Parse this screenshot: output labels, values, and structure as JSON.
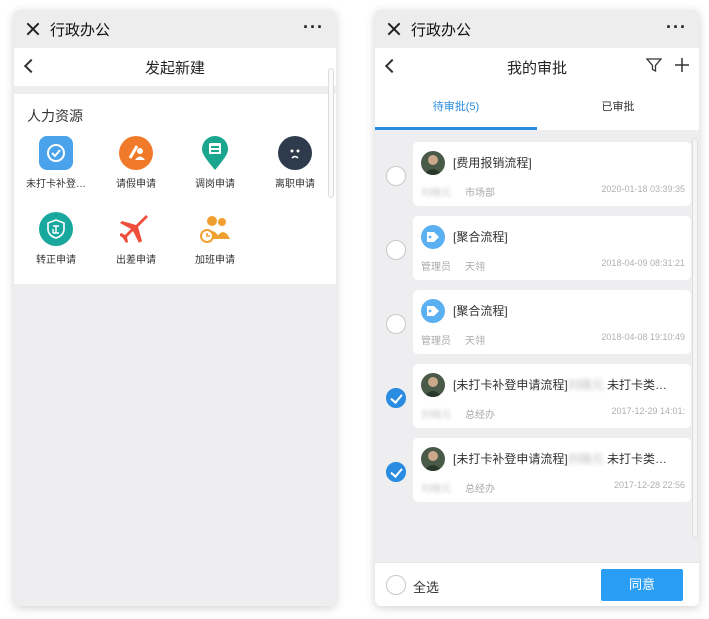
{
  "colors": {
    "accent": "#2a8ce0",
    "button": "#2a9df4"
  },
  "left": {
    "window_title": "行政办公",
    "more_label": "···",
    "nav_title": "发起新建",
    "section_title": "人力资源",
    "apps": [
      {
        "label": "未打卡补登…",
        "icon": "clock-check-icon",
        "color": "#4aa3ea"
      },
      {
        "label": "请假申请",
        "icon": "leave-icon",
        "color": "#f07a2a"
      },
      {
        "label": "调岗申请",
        "icon": "transfer-pin-icon",
        "color": "#1aa58f"
      },
      {
        "label": "离职申请",
        "icon": "resign-face-icon",
        "color": "#2e3b4c"
      },
      {
        "label": "转正申请",
        "icon": "regular-shield-icon",
        "color": "#19a89e"
      },
      {
        "label": "出差申请",
        "icon": "airplane-icon",
        "color": "#ef4f3a"
      },
      {
        "label": "加班申请",
        "icon": "overtime-icon",
        "color": "#f0a030"
      }
    ]
  },
  "right": {
    "window_title": "行政办公",
    "more_label": "···",
    "nav_title": "我的审批",
    "tabs": [
      "待审批(5)",
      "已审批"
    ],
    "items": [
      {
        "title": "[费用报销流程]",
        "user": "刘晓元",
        "dept": "市场部",
        "time": "2020-01-18 03:39:35",
        "checked": false,
        "avatar": "photo"
      },
      {
        "title": "[聚合流程]",
        "user": "管理员",
        "dept": "天翎",
        "time": "2018-04-09 08:31:21",
        "checked": false,
        "avatar": "tag"
      },
      {
        "title": "[聚合流程]",
        "user": "管理员",
        "dept": "天翎",
        "time": "2018-04-08 19:10:49",
        "checked": false,
        "avatar": "tag"
      },
      {
        "title": "[未打卡补登申请流程]",
        "title_blur": "刘晓元",
        "title_tail": " 未打卡类…",
        "user": "刘晓元",
        "dept": "总经办",
        "time": "2017-12-29 14:01:",
        "checked": true,
        "avatar": "photo"
      },
      {
        "title": "[未打卡补登申请流程]",
        "title_blur": "刘晓元",
        "title_tail": " 未打卡类…",
        "user": "刘晓元",
        "dept": "总经办",
        "time": "2017-12-28 22:56",
        "checked": true,
        "avatar": "photo"
      }
    ],
    "select_all": "全选",
    "agree": "同意"
  }
}
